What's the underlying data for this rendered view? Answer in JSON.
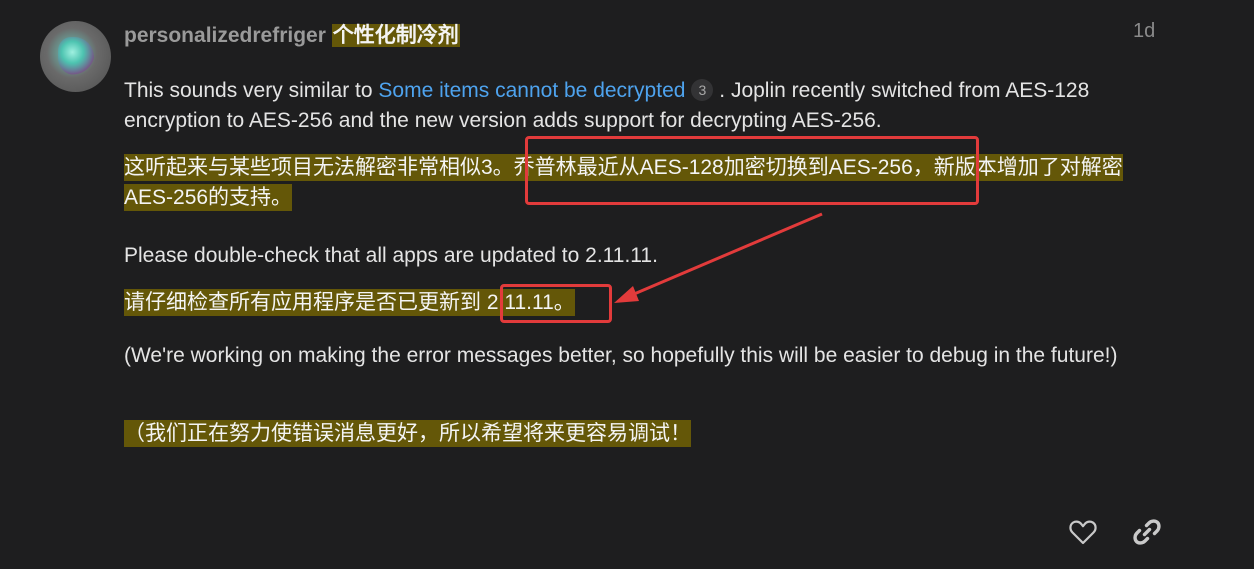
{
  "post": {
    "author_username": "personalizedrefriger",
    "author_translation": "个性化制冷剂",
    "time_ago": "1d",
    "p1": {
      "text_before": "This sounds very similar to ",
      "link_text": "Some items cannot be decrypted",
      "link_badge": "3",
      "text_after": " . Joplin recently switched from AES-128 encryption to AES-256 and the new version adds support for decrypting AES-256."
    },
    "p1_translation": "这听起来与某些项目无法解密非常相似3。乔普林最近从AES-128加密切换到AES-256，新版本增加了对解密AES-256的支持。",
    "p2": "Please double-check that all apps are updated to 2.11.11.",
    "p2_translation": "请仔细检查所有应用程序是否已更新到 2.11.11。",
    "p3": "(We're working on making the error messages better, so hopefully this will be easier to debug in the future!)",
    "p3_translation": "（我们正在努力使错误消息更好，所以希望将来更容易调试！"
  },
  "actions": {
    "like_icon": "heart-icon",
    "link_icon": "link-icon"
  },
  "colors": {
    "background": "#1e1e1f",
    "highlight": "#806e00",
    "link": "#4ea3ee",
    "annotation_red": "#e23b3b"
  }
}
